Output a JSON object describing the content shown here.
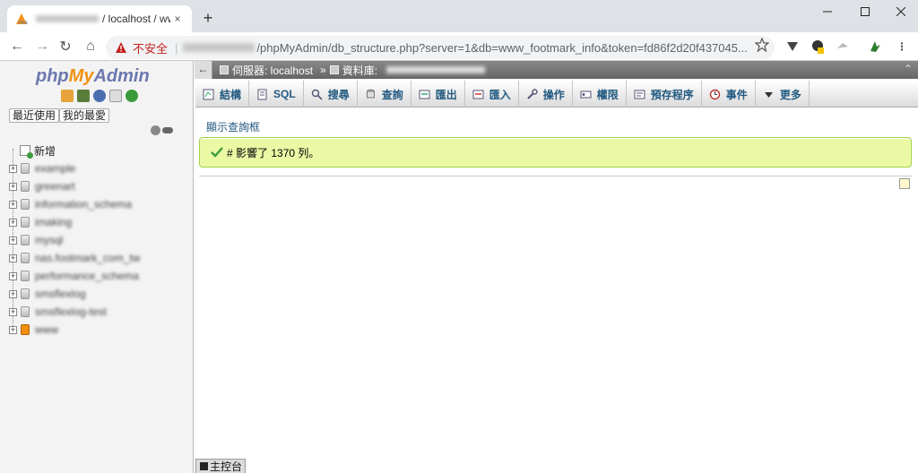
{
  "browser": {
    "tab_title": "/ localhost / www",
    "tab_close": "×",
    "new_tab": "+",
    "insecure_label": "不安全",
    "url_path": "/phpMyAdmin/db_structure.php?server=1&db=www_footmark_info&token=fd86f2d20f437045...",
    "nav": {
      "back": "←",
      "forward": "→",
      "reload": "↻",
      "home": "⌂"
    },
    "menu_dots": "⋮"
  },
  "pma": {
    "logo": {
      "php": "php",
      "my": "My",
      "admin": "Admin"
    },
    "recent_label": "最近使用",
    "favorites_label": "我的最愛",
    "tree": {
      "new_label": "新增",
      "databases": [
        "example",
        "greenart",
        "information_schema",
        "imaking",
        "mysql",
        "nas.footmark_com_tw",
        "performance_schema",
        "smsflexlog",
        "smsflexlog-test",
        "www"
      ]
    },
    "breadcrumb": {
      "server": "伺服器: localhost",
      "db": "資料庫:",
      "collapse": "←",
      "up": "⌃"
    },
    "menu": [
      {
        "label": "結構",
        "icon": "structure-icon"
      },
      {
        "label": "SQL",
        "icon": "sql-icon"
      },
      {
        "label": "搜尋",
        "icon": "search-icon"
      },
      {
        "label": "查詢",
        "icon": "query-icon"
      },
      {
        "label": "匯出",
        "icon": "export-icon"
      },
      {
        "label": "匯入",
        "icon": "import-icon"
      },
      {
        "label": "操作",
        "icon": "wrench-icon"
      },
      {
        "label": "權限",
        "icon": "privileges-icon"
      },
      {
        "label": "預存程序",
        "icon": "routines-icon"
      },
      {
        "label": "事件",
        "icon": "events-icon"
      },
      {
        "label": "更多",
        "icon": "chevron-down-icon"
      }
    ],
    "show_query_label": "顯示查詢框",
    "success_message": "# 影響了 1370 列。",
    "console_label": "主控台"
  }
}
